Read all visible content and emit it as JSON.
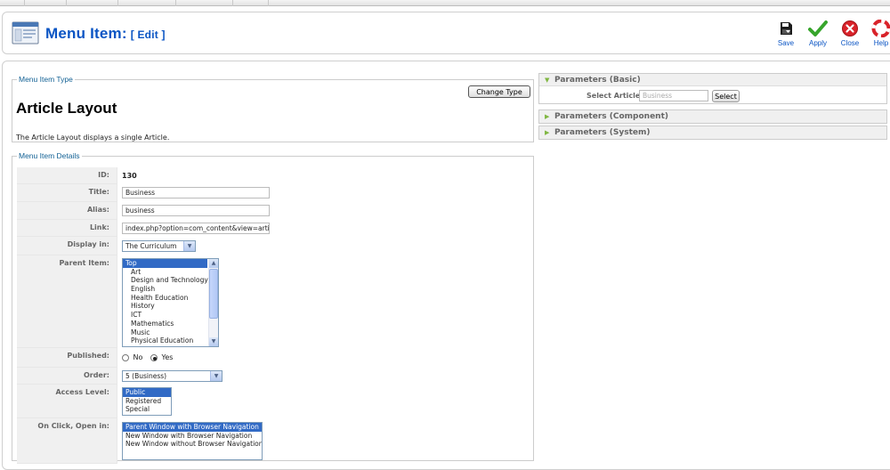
{
  "header": {
    "title": "Menu Item:",
    "subtitle": "[ Edit ]"
  },
  "toolbar": {
    "save_label": "Save",
    "apply_label": "Apply",
    "close_label": "Close",
    "help_label": "Help"
  },
  "menu_item_type": {
    "legend": "Menu Item Type",
    "change_button": "Change Type",
    "title": "Article Layout",
    "description": "The Article Layout displays a single Article."
  },
  "details": {
    "legend": "Menu Item Details",
    "id_label": "ID:",
    "id_value": "130",
    "title_label": "Title:",
    "title_value": "Business",
    "alias_label": "Alias:",
    "alias_value": "business",
    "link_label": "Link:",
    "link_value": "index.php?option=com_content&view=article&i",
    "display_label": "Display in:",
    "display_value": "The Curriculum",
    "parent_label": "Parent Item:",
    "parent_options": [
      "Top",
      "Art",
      "Design and Technology",
      "English",
      "Health Education",
      "History",
      "ICT",
      "Mathematics",
      "Music",
      "Physical Education"
    ],
    "published_label": "Published:",
    "published_no": "No",
    "published_yes": "Yes",
    "order_label": "Order:",
    "order_value": "5 (Business)",
    "access_label": "Access Level:",
    "access_options": [
      "Public",
      "Registered",
      "Special"
    ],
    "onclick_label": "On Click, Open in:",
    "onclick_options": [
      "Parent Window with Browser Navigation",
      "New Window with Browser Navigation",
      "New Window without Browser Navigation"
    ]
  },
  "params": {
    "basic_title": "Parameters (Basic)",
    "select_article_label": "Select Article",
    "select_article_value": "Business",
    "select_button": "Select",
    "component_title": "Parameters (Component)",
    "system_title": "Parameters (System)"
  },
  "colors": {
    "title_blue": "#0b55c4",
    "legend_blue": "#146295",
    "selection_blue": "#316ac5",
    "panel_arrow_green": "#80b742"
  }
}
